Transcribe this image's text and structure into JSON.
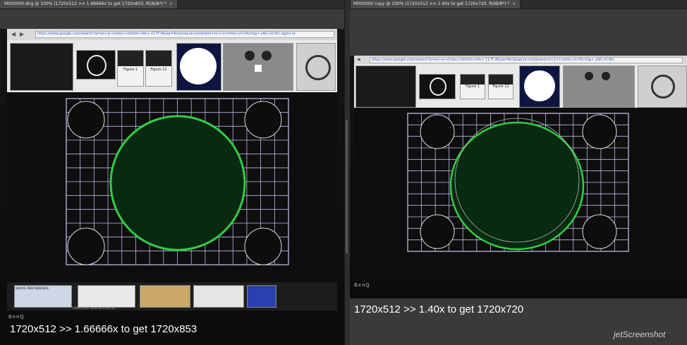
{
  "tabs": {
    "left": {
      "label": "M000000.dng @ 100% (1720x512 >> 1.66666x to get 1720x853, RGB/8*) *",
      "close": "×"
    },
    "right": {
      "label": "M000000 copy @ 100% (1720x512 >> 1.40x to get 1720x720, RGB/8*) *",
      "close": "×"
    }
  },
  "left_panel": {
    "caption": "1720x512 >> 1.66666x to get 1720x853",
    "url": "https://www.google.com/search?q=ex+yr+l/stec+/stfstm+life+ 117F-8&oq=Alc&oaq.te+aVqheed+tl+2+f.nshb+vl+OtcrGg+ yNC+0-6tc.sgyt+1c",
    "brand": "BenQ",
    "thumb_caption_1": "Figure 1",
    "thumb_caption_2": "Figure 12",
    "taskbar_label_1": "NOVICE PERFORMANCE",
    "taskbar_label_2": "CWIRD SSAI Services (Free 1B)"
  },
  "right_panel": {
    "caption": "1720x512 >> 1.40x to get 1720x720",
    "url": "https://www.google.com/search?q=ex+yr+l/stec+/stfstm+life+ 117F-8&oq=Alc&oaq.te+aVqheed+tl+2+f.nshb+vl+OtcrGg+ yNC+0-6tc",
    "brand": "BenQ",
    "thumb_caption_1": "Figure 1",
    "thumb_caption_2": "Figure 12"
  },
  "watermark": "jetScreenshot",
  "colors": {
    "circle": "#33cc44",
    "grid": "#c9c9f0",
    "fill": "#082a10"
  }
}
